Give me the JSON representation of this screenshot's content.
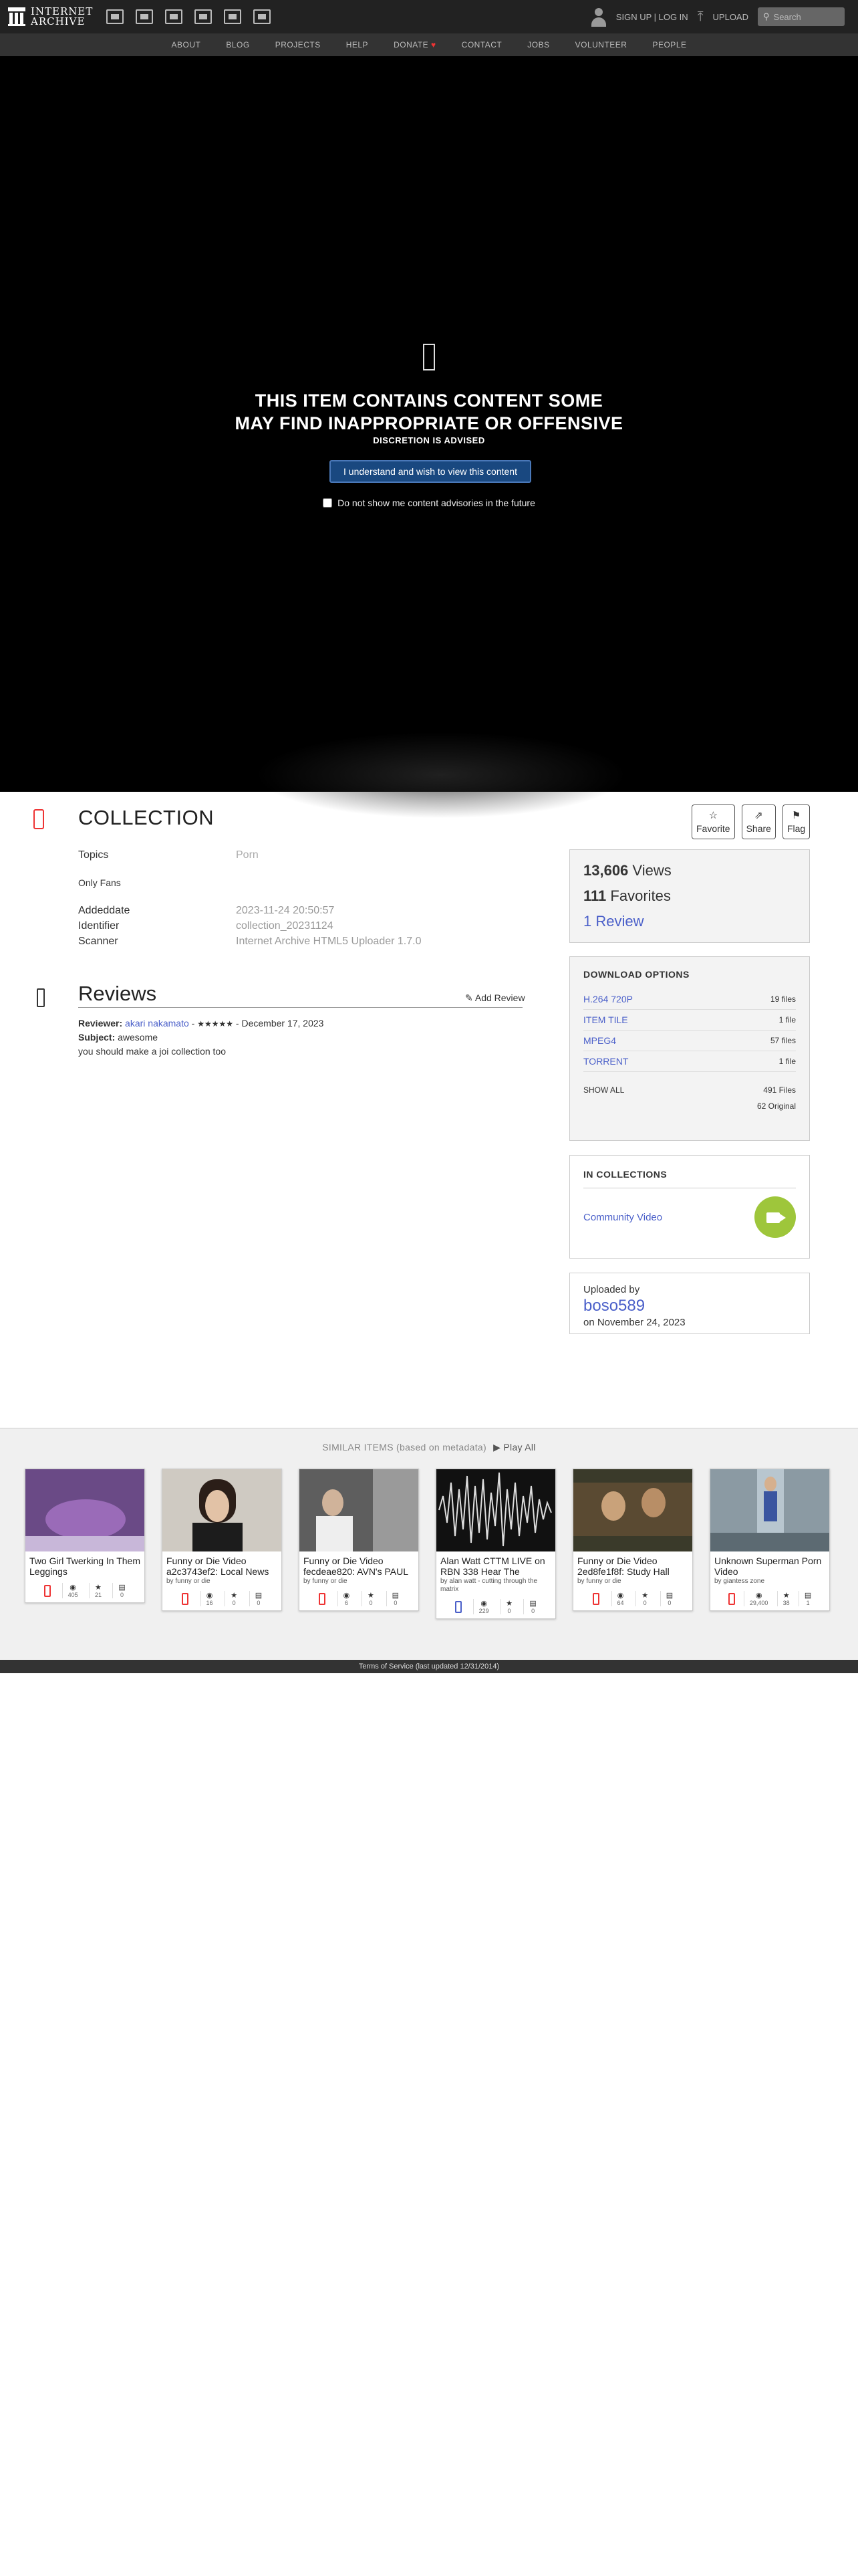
{
  "topnav": {
    "logo_line1": "INTERNET",
    "logo_line2": "ARCHIVE",
    "media_icons": [
      "web-icon",
      "texts-icon",
      "video-icon",
      "audio-icon",
      "software-icon",
      "images-icon"
    ],
    "signup": "SIGN UP | LOG IN",
    "upload": "UPLOAD",
    "search_placeholder": "Search"
  },
  "subnav": [
    "ABOUT",
    "BLOG",
    "PROJECTS",
    "HELP",
    "DONATE",
    "CONTACT",
    "JOBS",
    "VOLUNTEER",
    "PEOPLE"
  ],
  "advisory": {
    "title_line1": "THIS ITEM CONTAINS CONTENT SOME",
    "title_line2": "MAY FIND INAPPROPRIATE OR OFFENSIVE",
    "subtitle": "DISCRETION IS ADVISED",
    "button": "I understand and wish to view this content",
    "checkbox_label": "Do not show me content advisories in the future"
  },
  "item": {
    "title": "COLLECTION",
    "actions": [
      {
        "glyph": "☆",
        "label": "Favorite"
      },
      {
        "glyph": "⇗",
        "label": "Share"
      },
      {
        "glyph": "⚑",
        "label": "Flag"
      }
    ],
    "topics_label": "Topics",
    "topics_value": "Porn",
    "description": "Only Fans",
    "addeddate_label": "Addeddate",
    "addeddate_value": "2023-11-24 20:50:57",
    "identifier_label": "Identifier",
    "identifier_value": "collection_20231124",
    "scanner_label": "Scanner",
    "scanner_value": "Internet Archive HTML5 Uploader 1.7.0"
  },
  "reviews": {
    "title": "Reviews",
    "add": "Add Review",
    "reviewer_label": "Reviewer:",
    "reviewer": "akari nakamato",
    "stars": "★★★★★",
    "date": "December 17, 2023",
    "subject_label": "Subject:",
    "subject": "awesome",
    "body": "you should make a joi collection too"
  },
  "stats": {
    "views": "13,606",
    "views_label": "Views",
    "favorites": "111",
    "favorites_label": "Favorites",
    "reviews": "1 Review"
  },
  "downloads": {
    "heading": "DOWNLOAD OPTIONS",
    "rows": [
      {
        "name": "H.264 720P",
        "count": "19 files"
      },
      {
        "name": "ITEM TILE",
        "count": "1 file"
      },
      {
        "name": "MPEG4",
        "count": "57 files"
      },
      {
        "name": "TORRENT",
        "count": "1 file"
      }
    ],
    "show_all": "SHOW ALL",
    "total": "491 Files",
    "original": "62 Original"
  },
  "collections": {
    "heading": "IN COLLECTIONS",
    "name": "Community Video"
  },
  "uploader": {
    "label": "Uploaded by",
    "user": "boso589",
    "date": "on November 24, 2023"
  },
  "similar": {
    "heading": "SIMILAR ITEMS (based on metadata)",
    "play": "Play All",
    "cards": [
      {
        "title": "Two Girl Twerking In Them Leggings",
        "by": "",
        "views": "405",
        "favs": "21",
        "reviews": "0",
        "thumb_color": "#6a4a86"
      },
      {
        "title": "Funny or Die Video a2c3743ef2: Local News",
        "by": "by funny or die",
        "views": "16",
        "favs": "0",
        "reviews": "0",
        "thumb_color": "#b9b6b0"
      },
      {
        "title": "Funny or Die Video fecdeae820: AVN's PAUL",
        "by": "by funny or die",
        "views": "6",
        "favs": "0",
        "reviews": "0",
        "thumb_color": "#6b6b6b"
      },
      {
        "title": "Alan Watt CTTM LIVE on RBN 338 Hear The",
        "by": "by alan watt - cutting through the matrix",
        "views": "229",
        "favs": "0",
        "reviews": "0",
        "thumb_color": "#111111"
      },
      {
        "title": "Funny or Die Video 2ed8fe1f8f: Study Hall",
        "by": "by funny or die",
        "views": "64",
        "favs": "0",
        "reviews": "0",
        "thumb_color": "#5a4a32"
      },
      {
        "title": "Unknown Superman Porn Video",
        "by": "by giantess zone",
        "views": "29,400",
        "favs": "38",
        "reviews": "1",
        "thumb_color": "#8b9aa3"
      }
    ]
  },
  "footer": "Terms of Service (last updated 12/31/2014)"
}
